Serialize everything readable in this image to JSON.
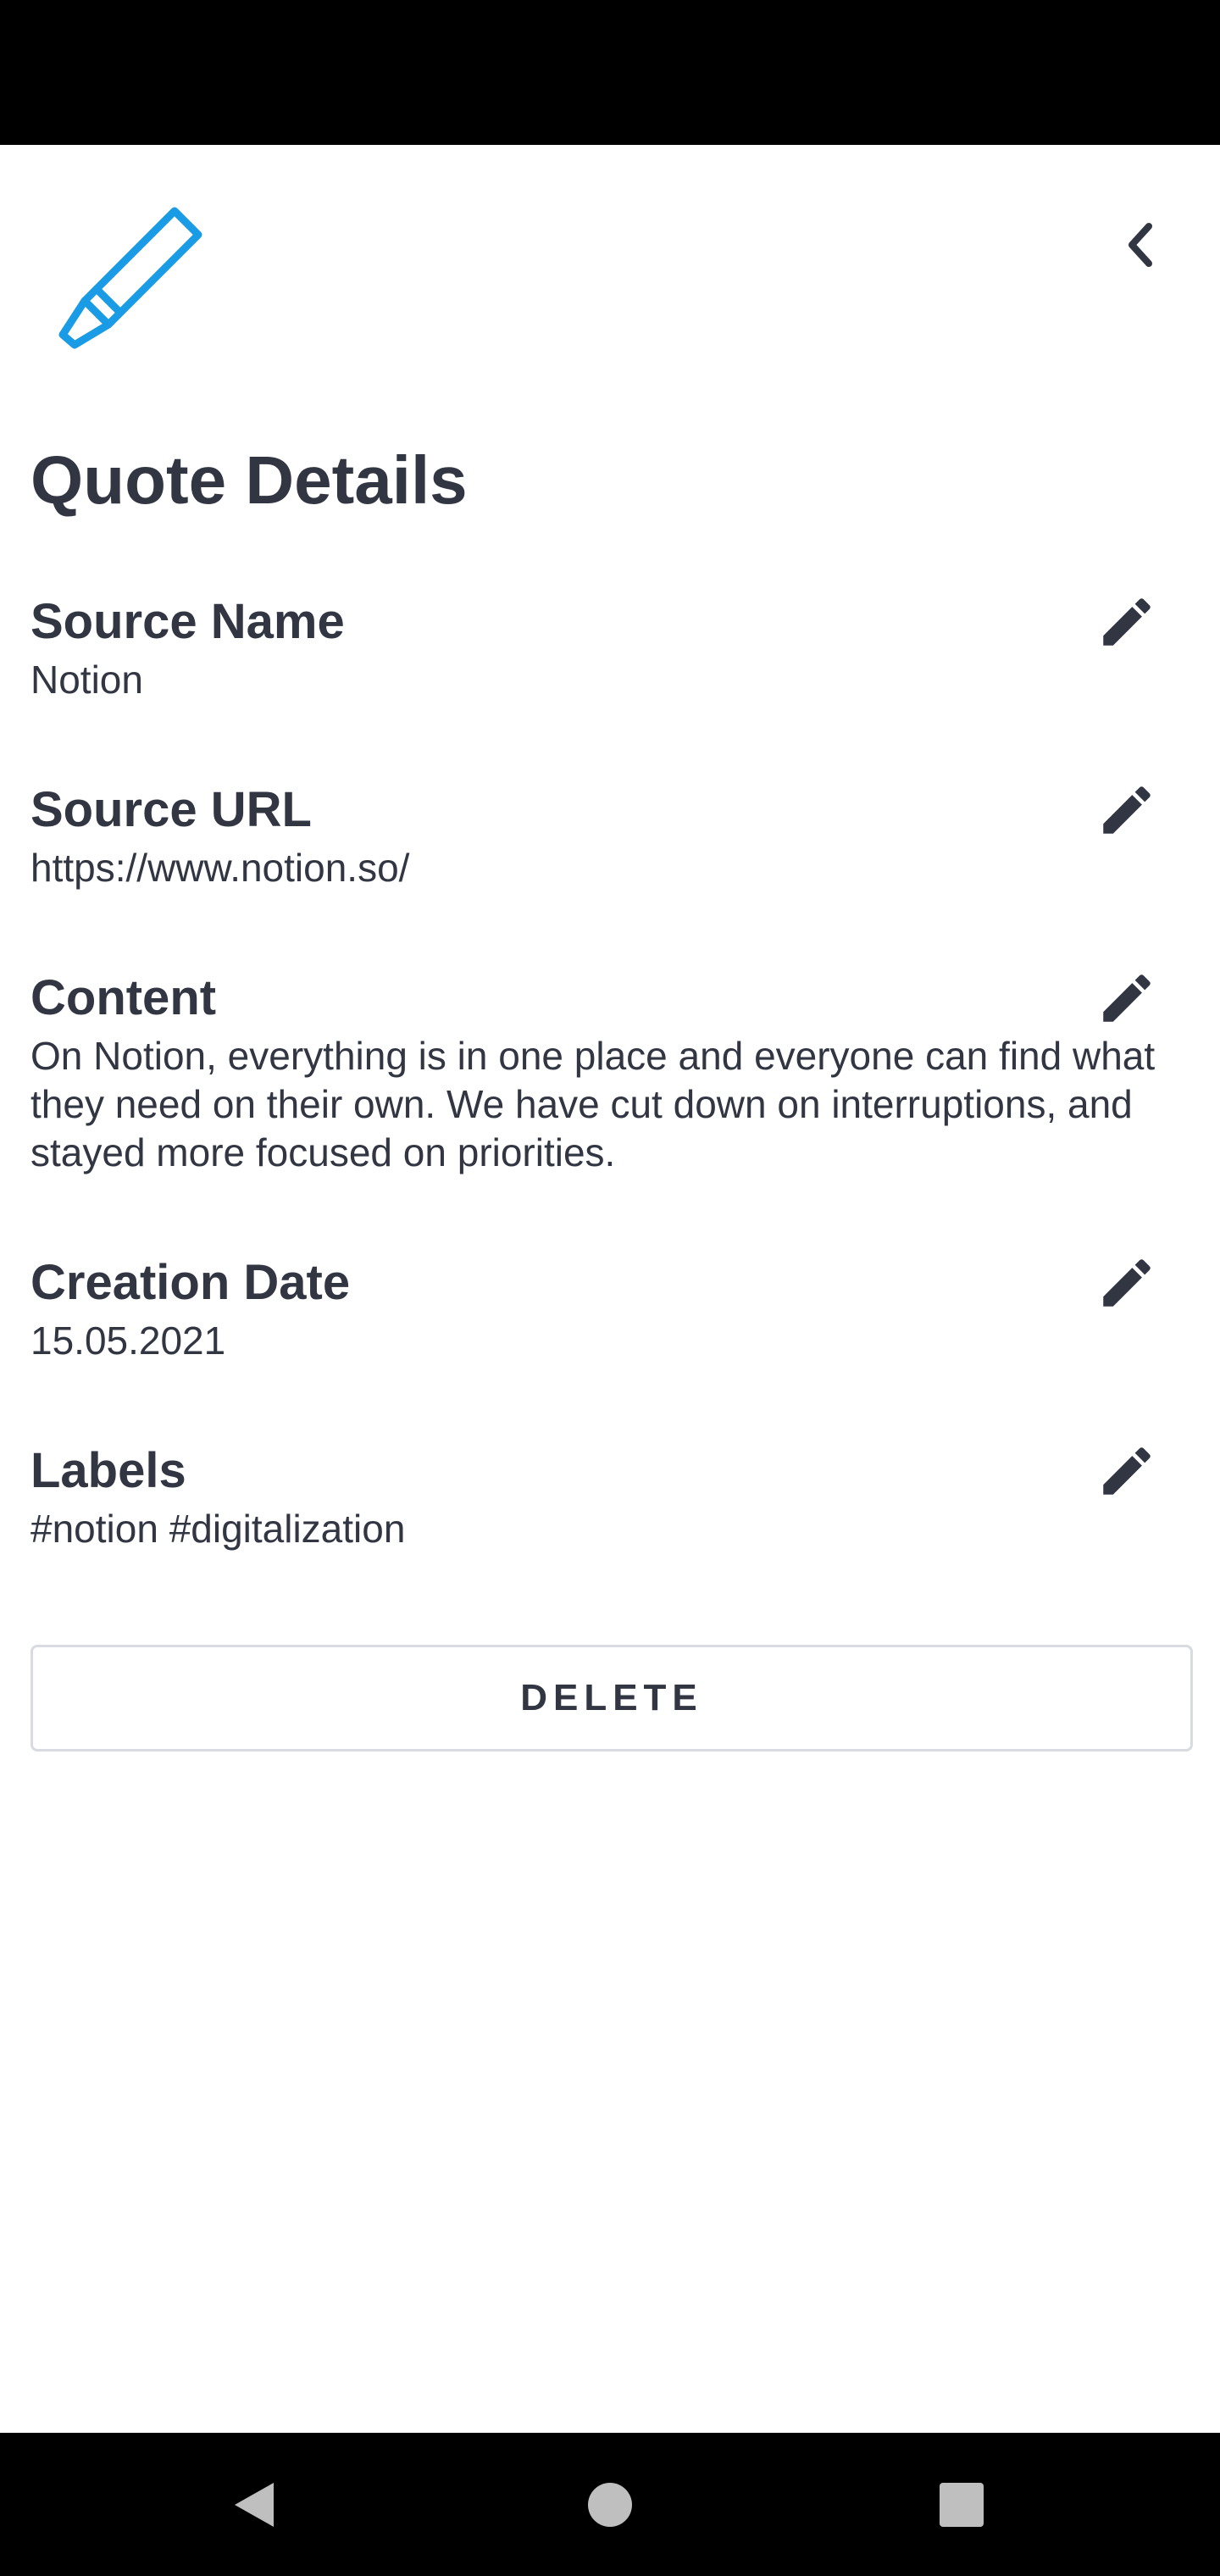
{
  "colors": {
    "accent": "#1a9be6",
    "text": "#323643",
    "border": "#d9dbe0",
    "system_bar": "#000000"
  },
  "header": {
    "logo_icon": "highlighter-icon",
    "back_icon": "chevron-left-icon"
  },
  "page": {
    "title": "Quote Details"
  },
  "fields": [
    {
      "label": "Source Name",
      "value": "Notion",
      "edit_icon": "pencil-icon"
    },
    {
      "label": "Source URL",
      "value": "https://www.notion.so/",
      "edit_icon": "pencil-icon"
    },
    {
      "label": "Content",
      "value": "On Notion, everything is in one place and everyone can find what they need on their own. We have cut down on interruptions, and stayed more focused on priorities.",
      "edit_icon": "pencil-icon"
    },
    {
      "label": "Creation Date",
      "value": "15.05.2021",
      "edit_icon": "pencil-icon"
    },
    {
      "label": "Labels",
      "value": "#notion #digitalization",
      "edit_icon": "pencil-icon"
    }
  ],
  "actions": {
    "delete_label": "DELETE"
  },
  "navigation": {
    "back_icon": "nav-back-icon",
    "home_icon": "nav-home-icon",
    "recents_icon": "nav-recents-icon"
  }
}
